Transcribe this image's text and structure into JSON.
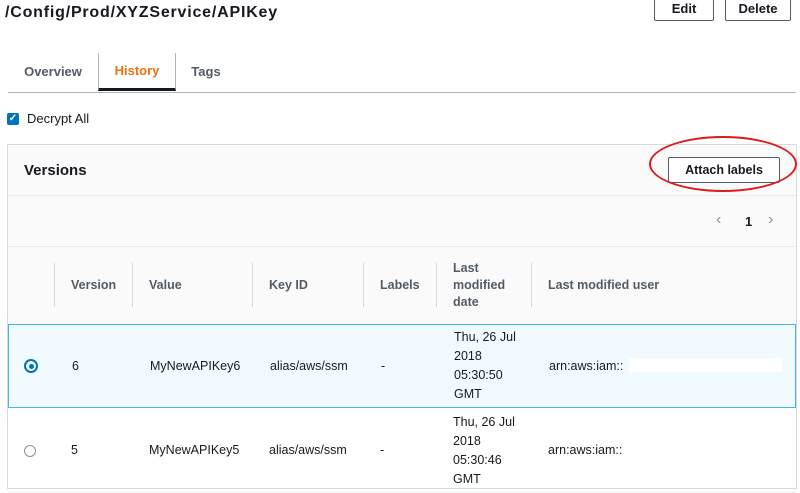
{
  "header": {
    "title": "/Config/Prod/XYZService/APIKey",
    "edit_label": "Edit",
    "delete_label": "Delete"
  },
  "tabs": [
    {
      "label": "Overview",
      "active": false
    },
    {
      "label": "History",
      "active": true
    },
    {
      "label": "Tags",
      "active": false
    }
  ],
  "decrypt": {
    "label": "Decrypt All",
    "checked": true
  },
  "versions": {
    "title": "Versions",
    "attach_label": "Attach labels",
    "pager": {
      "prev": "‹",
      "page": "1",
      "next": "›"
    },
    "columns": [
      "Version",
      "Value",
      "Key ID",
      "Labels",
      "Last modified date",
      "Last modified user"
    ],
    "rows": [
      {
        "selected": true,
        "version": "6",
        "value": "MyNewAPIKey6",
        "key_id": "alias/aws/ssm",
        "labels": "-",
        "date": "Thu, 26 Jul 2018 05:30:50 GMT",
        "user": "arn:aws:iam::"
      },
      {
        "selected": false,
        "version": "5",
        "value": "MyNewAPIKey5",
        "key_id": "alias/aws/ssm",
        "labels": "-",
        "date": "Thu, 26 Jul 2018 05:30:46 GMT",
        "user": "arn:aws:iam::"
      }
    ]
  },
  "colors": {
    "accent_tab": "#ec7211",
    "primary_blue": "#0073bb",
    "highlight_ring": "#d91c1c"
  }
}
